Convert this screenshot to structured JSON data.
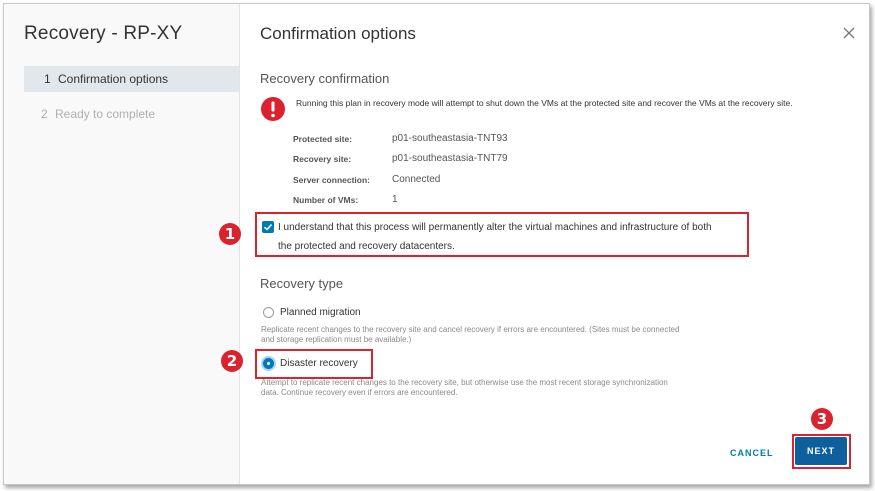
{
  "dialog": {
    "title": "Recovery - RP-XY",
    "steps": [
      {
        "num": "1",
        "label": "Confirmation options",
        "active": true
      },
      {
        "num": "2",
        "label": "Ready to complete",
        "active": false
      }
    ]
  },
  "main": {
    "title": "Confirmation options",
    "recovery_confirmation": {
      "heading": "Recovery confirmation",
      "warning": "Running this plan in recovery mode will attempt to shut down the VMs at the protected site and recover the VMs at the recovery site.",
      "fields": [
        {
          "label": "Protected site:",
          "value": "p01-southeastasia-TNT93"
        },
        {
          "label": "Recovery site:",
          "value": "p01-southeastasia-TNT79"
        },
        {
          "label": "Server connection:",
          "value": "Connected"
        },
        {
          "label": "Number of VMs:",
          "value": "1"
        }
      ],
      "acknowledge": {
        "checked": true,
        "line1": "I understand that this process will permanently alter the virtual machines and infrastructure of both",
        "line2": "the protected and recovery datacenters."
      }
    },
    "recovery_type": {
      "heading": "Recovery type",
      "options": [
        {
          "label": "Planned migration",
          "selected": false,
          "help1": "Replicate recent changes to the recovery site and cancel recovery if errors are encountered. (Sites must be connected",
          "help2": "and storage replication must be available.)"
        },
        {
          "label": "Disaster recovery",
          "selected": true,
          "help1": "Attempt to replicate recent changes to the recovery site, but otherwise use the most recent storage synchronization",
          "help2": "data. Continue recovery even if errors are encountered."
        }
      ]
    }
  },
  "footer": {
    "cancel_label": "CANCEL",
    "next_label": "NEXT"
  },
  "annotations": {
    "badge1": "1",
    "badge2": "2",
    "badge3": "3"
  },
  "colors": {
    "accent": "#0079b8",
    "primary_button": "#0d5f9e",
    "highlight": "#d9232e",
    "warning": "#d9232e"
  }
}
